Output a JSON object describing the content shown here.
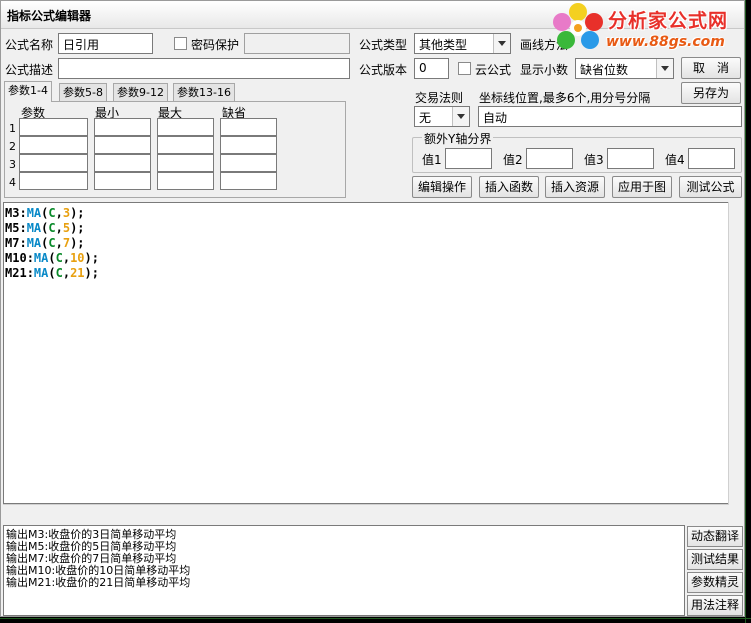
{
  "window": {
    "title": "指标公式编辑器"
  },
  "logo": {
    "text": "分析家公式网",
    "url_text": "www.88gs.com"
  },
  "form": {
    "name_label": "公式名称",
    "name_value": "日引用",
    "password_label": "密码保护",
    "type_label": "公式类型",
    "type_value": "其他类型",
    "draw_label": "画线方法",
    "desc_label": "公式描述",
    "version_label": "公式版本",
    "version_value": "0",
    "cloud_label": "云公式",
    "decimal_label": "显示小数",
    "decimal_value": "缺省位数",
    "trade_label": "交易法则",
    "trade_value": "无",
    "coord_label": "坐标线位置,最多6个,用分号分隔",
    "coord_value": "自动",
    "yaxis_label": "额外Y轴分界",
    "y_values": [
      "值1",
      "值2",
      "值3",
      "值4"
    ]
  },
  "buttons": {
    "cancel": "取　消",
    "save_as": "另存为",
    "edit": "编辑操作",
    "insert_func": "插入函数",
    "insert_res": "插入资源",
    "apply": "应用于图",
    "test": "测试公式"
  },
  "tabs": [
    "参数1-4",
    "参数5-8",
    "参数9-12",
    "参数13-16"
  ],
  "param_headers": [
    "参数",
    "最小",
    "最大",
    "缺省"
  ],
  "param_rows": [
    "1",
    "2",
    "3",
    "4"
  ],
  "code_lines": [
    {
      "name": "M3",
      "fn": "MA",
      "arg": "C",
      "num": "3"
    },
    {
      "name": "M5",
      "fn": "MA",
      "arg": "C",
      "num": "5"
    },
    {
      "name": "M7",
      "fn": "MA",
      "arg": "C",
      "num": "7"
    },
    {
      "name": "M10",
      "fn": "MA",
      "arg": "C",
      "num": "10"
    },
    {
      "name": "M21",
      "fn": "MA",
      "arg": "C",
      "num": "21"
    }
  ],
  "output_lines": [
    "输出M3:收盘价的3日简单移动平均",
    "输出M5:收盘价的5日简单移动平均",
    "输出M7:收盘价的7日简单移动平均",
    "输出M10:收盘价的10日简单移动平均",
    "输出M21:收盘价的21日简单移动平均"
  ],
  "side_buttons": [
    "动态翻译",
    "测试结果",
    "参数精灵",
    "用法注释"
  ]
}
